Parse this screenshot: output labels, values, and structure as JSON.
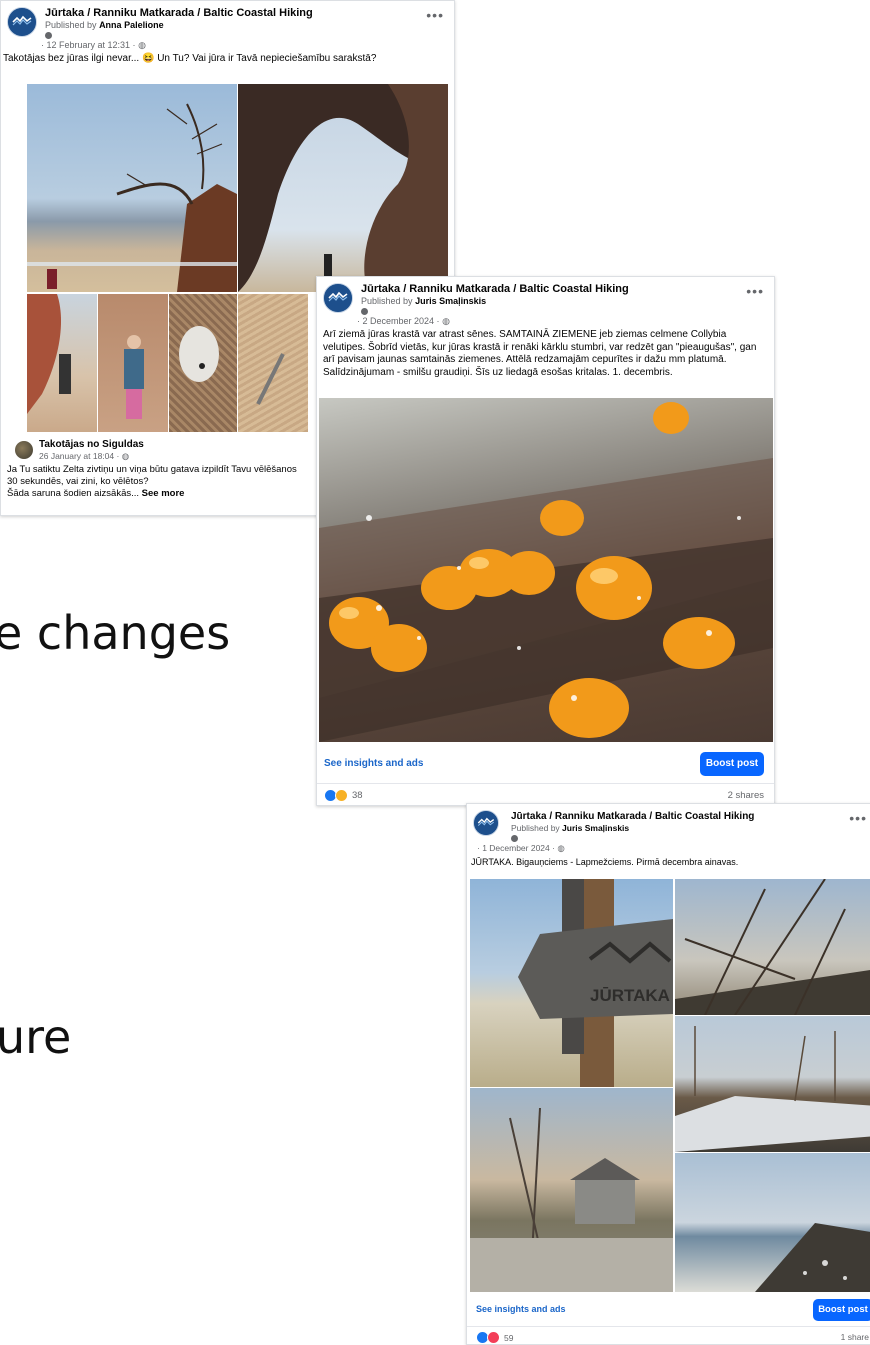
{
  "slide": {
    "fragment_changes": "e changes",
    "fragment_ure": "ure"
  },
  "post1": {
    "page_name": "Jūrtaka / Ranniku Matkarada / Baltic Coastal Hiking",
    "published_prefix": "Published by",
    "publisher": "Anna Palelione",
    "date": "· 12 February at 12:31 ·",
    "text": "Takotājas bez jūras ilgi nevar... 😆 Un Tu? Vai jūra ir Tavā nepieciešamību sarakstā?",
    "comment": {
      "name": "Takotājas no Siguldas",
      "date": "26 January at 18:04 ·",
      "line1": "Ja Tu satiktu Zelta zivtiņu un viņa būtu gatava izpildīt Tavu vēlēšanos",
      "line2": "30 sekundēs, vai zini, ko vēlētos?",
      "line3": "Šāda saruna šodien aizsākās...",
      "see_more": "See more"
    }
  },
  "post2": {
    "page_name": "Jūrtaka / Ranniku Matkarada / Baltic Coastal Hiking",
    "published_prefix": "Published by",
    "publisher": "Juris Smaļinskis",
    "date": "· 2 December 2024 ·",
    "text": "Arī ziemā jūras krastā var atrast sēnes. SAMTAINĀ ZIEMENE jeb ziemas celmene Collybia velutipes. Šobrīd vietās, kur jūras krastā ir renāki kārklu stumbri, var redzēt gan \"pieaugušas\", gan arī pavisam jaunas samtainās ziemenes. Attēlā redzamajām cepurītes ir dažu mm platumā. Salīdzinājumam - smilšu graudiņi. Šīs uz liedagā esošas kritalas. 1. decembris.",
    "insights": "See insights and ads",
    "boost": "Boost post",
    "reactions": "38",
    "shares": "2 shares"
  },
  "post3": {
    "page_name": "Jūrtaka / Ranniku Matkarada / Baltic Coastal Hiking",
    "published_prefix": "Published by",
    "publisher": "Juris Smaļinskis",
    "date": "· 1 December 2024 ·",
    "text": "JŪRTAKA. Bigauņciems - Lapmežciems. Pirmā decembra ainavas.",
    "sign_text": "JŪRTAKA",
    "insights": "See insights and ads",
    "boost": "Boost post",
    "reactions": "59",
    "shares": "1 share"
  },
  "colors": {
    "accent_blue": "#0866ff",
    "link_blue": "#1b66c9",
    "muted": "#65676b",
    "brand_avatar": "#1d4f8c"
  },
  "icons": {
    "more": "more-options-icon",
    "globe": "globe-icon",
    "like": "like-reaction-icon",
    "love": "love-reaction-icon",
    "wow": "wow-reaction-icon"
  }
}
